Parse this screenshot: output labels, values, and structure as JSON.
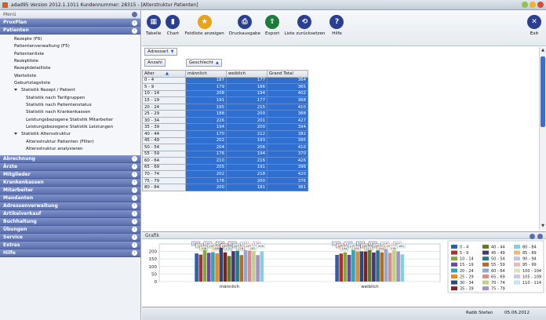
{
  "window": {
    "title": "adad95  Version 2012.1.1011  Kundennummer: 28315 - [Alterstruktur Patienten]"
  },
  "sidebar": {
    "header": "Menü",
    "sections_top": [
      {
        "label": "ProxPlan"
      },
      {
        "label": "Patienten"
      }
    ],
    "items": [
      {
        "label": "Rezepte (F6)",
        "level": 1
      },
      {
        "label": "Patientenverwaltung (F5)",
        "level": 1
      },
      {
        "label": "Patientenliste",
        "level": 1
      },
      {
        "label": "Rezeptliste",
        "level": 1
      },
      {
        "label": "Rezeptdetailliste",
        "level": 1
      },
      {
        "label": "Warteliste",
        "level": 1
      },
      {
        "label": "Geburtstagsliste",
        "level": 1
      },
      {
        "label": "Statistik Rezept / Patient",
        "level": 0
      },
      {
        "label": "Statistik nach Tarifgruppen",
        "level": 2
      },
      {
        "label": "Statistik nach Patientenstatus",
        "level": 2
      },
      {
        "label": "Statistik nach Krankenkassen",
        "level": 2
      },
      {
        "label": "Leistungsbezogene Statistik Mitarbeiter",
        "level": 2
      },
      {
        "label": "Leistungsbezogene Statistik Leistungen",
        "level": 2
      },
      {
        "label": "Statistik Altersstruktur",
        "level": 0
      },
      {
        "label": "Altersstruktur Patienten (Filter)",
        "level": 2
      },
      {
        "label": "Altersstruktur analysieren",
        "level": 2
      }
    ],
    "sections_bottom": [
      {
        "label": "Abrechnung"
      },
      {
        "label": "Ärzte"
      },
      {
        "label": "Mitglieder"
      },
      {
        "label": "Krankenkassen"
      },
      {
        "label": "Mitarbeiter"
      },
      {
        "label": "Mandanten"
      },
      {
        "label": "Adressenverwaltung"
      },
      {
        "label": "Artikelverkauf"
      },
      {
        "label": "Buchhaltung"
      },
      {
        "label": "Übungen"
      },
      {
        "label": "Service"
      },
      {
        "label": "Extras"
      },
      {
        "label": "Hilfe"
      }
    ]
  },
  "toolbar": {
    "buttons": [
      {
        "label": "Tabelle",
        "icon": "table-icon",
        "color": "#2a3f8f"
      },
      {
        "label": "Chart",
        "icon": "chart-icon",
        "color": "#2a3f8f"
      },
      {
        "label": "Feldliste anzeigen",
        "icon": "star-icon",
        "color": "#e7a41a"
      },
      {
        "label": "Druckausgabe",
        "icon": "printer-icon",
        "color": "#2a3f8f"
      },
      {
        "label": "Export",
        "icon": "export-icon",
        "color": "#1e7a3a"
      },
      {
        "label": "Liste zurücksetzen",
        "icon": "reset-icon",
        "color": "#2a3f8f"
      },
      {
        "label": "Hilfe",
        "icon": "help-icon",
        "color": "#2a3f8f"
      }
    ],
    "exit_label": "Exit"
  },
  "pivot": {
    "filter_label": "Adressart",
    "data_field": "Anzahl",
    "column_field": "Geschlecht",
    "row_field": "Alter",
    "columns": [
      "männlich",
      "weiblich",
      "Grand Total"
    ],
    "rows": [
      {
        "label": "0 - 4",
        "values": [
          187,
          177,
          364
        ]
      },
      {
        "label": "5 - 9",
        "values": [
          179,
          186,
          365
        ]
      },
      {
        "label": "10 - 14",
        "values": [
          208,
          194,
          402
        ]
      },
      {
        "label": "15 - 19",
        "values": [
          191,
          177,
          368
        ]
      },
      {
        "label": "20 - 24",
        "values": [
          195,
          215,
          410
        ]
      },
      {
        "label": "25 - 29",
        "values": [
          188,
          200,
          388
        ]
      },
      {
        "label": "30 - 34",
        "values": [
          226,
          201,
          427
        ]
      },
      {
        "label": "35 - 39",
        "values": [
          194,
          200,
          394
        ]
      },
      {
        "label": "40 - 44",
        "values": [
          170,
          212,
          382
        ]
      },
      {
        "label": "45 - 49",
        "values": [
          202,
          193,
          395
        ]
      },
      {
        "label": "50 - 54",
        "values": [
          204,
          206,
          410
        ]
      },
      {
        "label": "55 - 59",
        "values": [
          176,
          194,
          370
        ]
      },
      {
        "label": "60 - 64",
        "values": [
          210,
          216,
          426
        ]
      },
      {
        "label": "65 - 69",
        "values": [
          205,
          191,
          396
        ]
      },
      {
        "label": "70 - 74",
        "values": [
          202,
          218,
          420
        ]
      },
      {
        "label": "75 - 79",
        "values": [
          176,
          200,
          376
        ]
      },
      {
        "label": "80 - 84",
        "values": [
          200,
          181,
          381
        ]
      }
    ]
  },
  "chart_panel": {
    "title": "Grafik"
  },
  "chart_data": {
    "type": "bar",
    "categories": [
      "männlich",
      "weiblich"
    ],
    "ylim": [
      0,
      250
    ],
    "yticks": [
      0,
      50,
      100,
      150,
      200
    ],
    "series": [
      {
        "name": "0 - 4",
        "color": "#2f5fa8",
        "values": [
          187,
          177
        ]
      },
      {
        "name": "5 - 9",
        "color": "#a83232",
        "values": [
          179,
          186
        ]
      },
      {
        "name": "10 - 14",
        "color": "#86a83a",
        "values": [
          208,
          194
        ]
      },
      {
        "name": "15 - 19",
        "color": "#6a4aa0",
        "values": [
          191,
          177
        ]
      },
      {
        "name": "20 - 24",
        "color": "#2fa3b8",
        "values": [
          195,
          215
        ]
      },
      {
        "name": "25 - 29",
        "color": "#e08a2a",
        "values": [
          188,
          200
        ]
      },
      {
        "name": "30 - 34",
        "color": "#2a4a7f",
        "values": [
          226,
          201
        ]
      },
      {
        "name": "35 - 39",
        "color": "#7a2222",
        "values": [
          194,
          200
        ]
      },
      {
        "name": "40 - 44",
        "color": "#5f7a2a",
        "values": [
          170,
          212
        ]
      },
      {
        "name": "45 - 49",
        "color": "#4a3478",
        "values": [
          202,
          193
        ]
      },
      {
        "name": "50 - 54",
        "color": "#23798a",
        "values": [
          204,
          206
        ]
      },
      {
        "name": "55 - 59",
        "color": "#b86a1e",
        "values": [
          176,
          194
        ]
      },
      {
        "name": "60 - 64",
        "color": "#8fa9d6",
        "values": [
          210,
          216
        ]
      },
      {
        "name": "65 - 69",
        "color": "#d98c8c",
        "values": [
          205,
          191
        ]
      },
      {
        "name": "70 - 74",
        "color": "#bdd38a",
        "values": [
          202,
          218
        ]
      },
      {
        "name": "75 - 79",
        "color": "#a48fc6",
        "values": [
          176,
          200
        ]
      },
      {
        "name": "80 - 84",
        "color": "#86cfdd",
        "values": [
          200,
          181
        ]
      },
      {
        "name": "85 - 89",
        "color": "#f2b77a",
        "values": [
          null,
          null
        ]
      },
      {
        "name": "90 - 94",
        "color": "#b7c9e6",
        "values": [
          null,
          null
        ]
      },
      {
        "name": "95 - 99",
        "color": "#e8baba",
        "values": [
          null,
          null
        ]
      },
      {
        "name": "100 - 104",
        "color": "#dbe6bf",
        "values": [
          null,
          null
        ]
      },
      {
        "name": "105 - 109",
        "color": "#d3c6e3",
        "values": [
          null,
          null
        ]
      },
      {
        "name": "110 - 114",
        "color": "#bfe6ee",
        "values": [
          null,
          null
        ]
      }
    ],
    "legend": "right"
  },
  "status": {
    "user": "Rabb Stefan",
    "date": "05.06.2012"
  }
}
